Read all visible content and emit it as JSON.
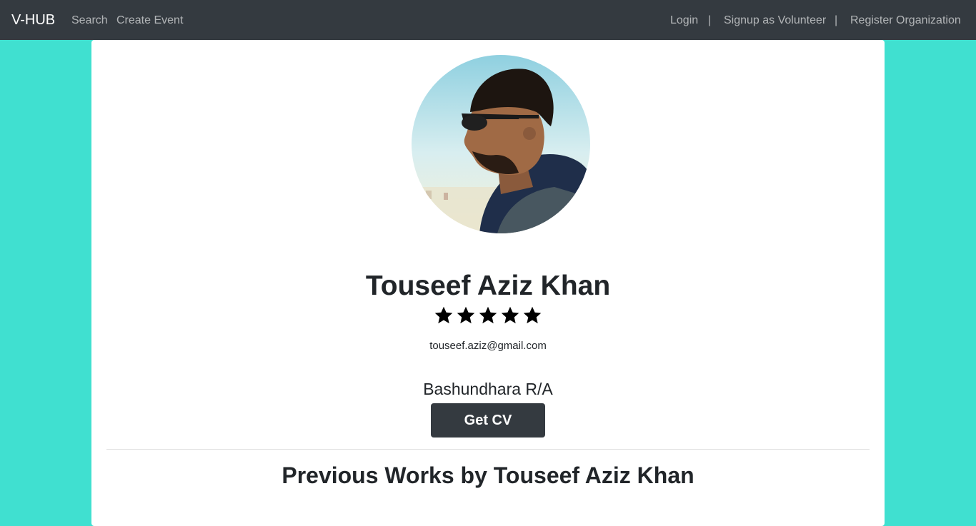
{
  "navbar": {
    "brand": "V-HUB",
    "search_label": "Search",
    "create_event_label": "Create Event",
    "login_label": "Login",
    "separator": "|",
    "signup_label": "Signup as Volunteer",
    "register_label": "Register Organization",
    "background_color": "#343a40"
  },
  "page": {
    "background_color": "#40e0d0"
  },
  "profile": {
    "avatar_icon": "profile-photo",
    "name": "Touseef Aziz Khan",
    "rating_stars": 5,
    "rating_max": 5,
    "email": "touseef.aziz@gmail.com",
    "location": "Bashundhara R/A",
    "get_cv_label": "Get CV"
  },
  "previous_works": {
    "title": "Previous Works by Touseef Aziz Khan"
  }
}
